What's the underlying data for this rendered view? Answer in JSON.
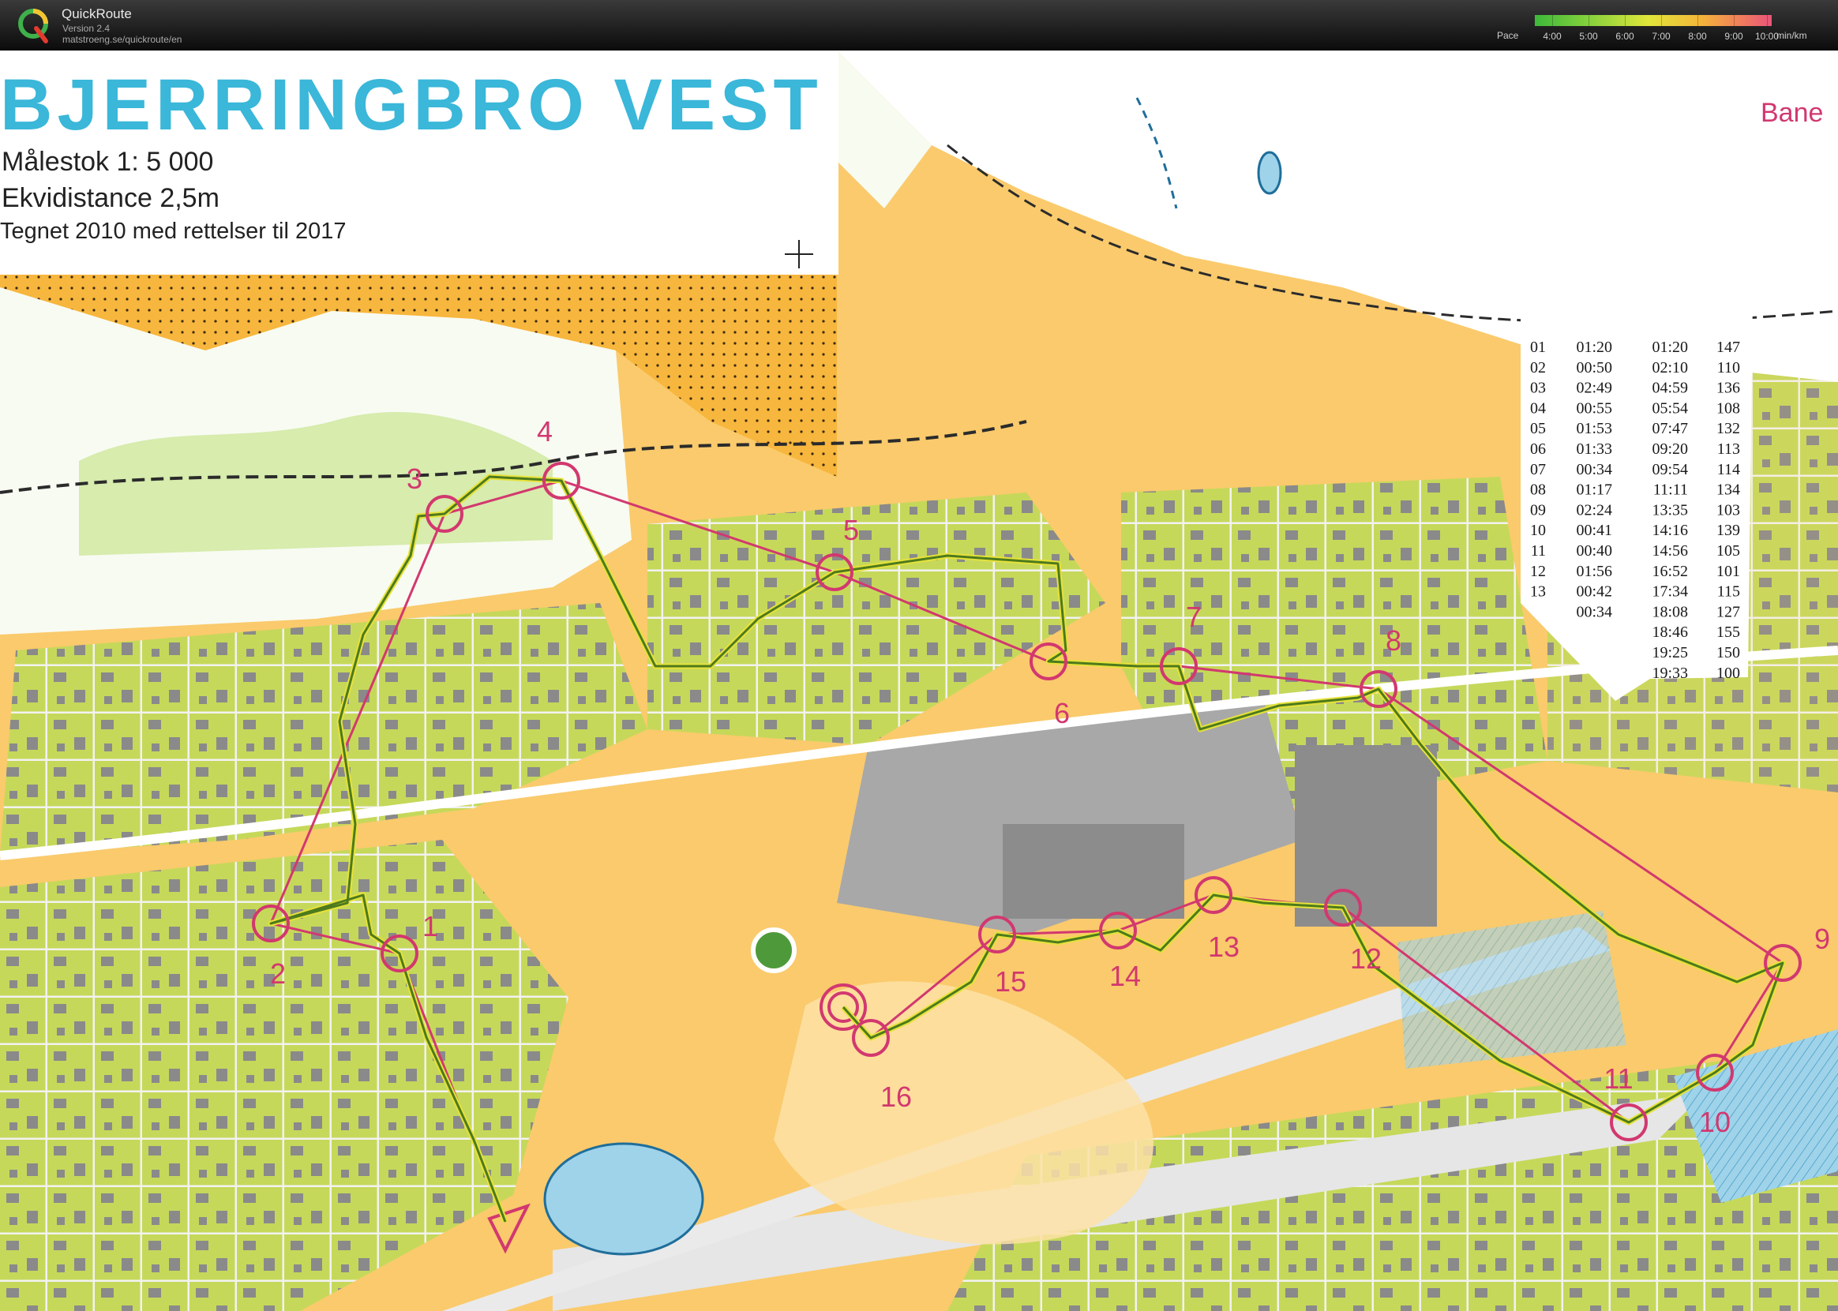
{
  "app": {
    "name": "QuickRoute",
    "version": "Version 2.4",
    "url": "matstroeng.se/quickroute/en"
  },
  "pace_scale": {
    "label": "Pace",
    "ticks": [
      "4:00",
      "5:00",
      "6:00",
      "7:00",
      "8:00",
      "9:00",
      "10:00"
    ],
    "unit": "min/km",
    "colors": [
      "#3db93a",
      "#8dd33d",
      "#e0e63a",
      "#f4b43a",
      "#ef7a5e",
      "#e9547b"
    ]
  },
  "map": {
    "title": "BJERRINGBRO  VEST",
    "scale": "Målestok 1: 5 000",
    "contour": "Ekvidistance 2,5m",
    "drawn": "Tegnet 2010 med rettelser til 2017",
    "course_label": "Bane",
    "colors": {
      "open": "#f7b63d",
      "rough_open": "#fde2a6",
      "forest": "#ffffff",
      "green": "#c9e590",
      "residential": "#c6d85a",
      "water": "#9fd3ea",
      "building": "#8c8c8c",
      "overprint": "#d2386f",
      "route": "#4d7a1d"
    },
    "controls": [
      {
        "label": "1"
      },
      {
        "label": "2"
      },
      {
        "label": "3"
      },
      {
        "label": "4"
      },
      {
        "label": "5"
      },
      {
        "label": "6"
      },
      {
        "label": "7"
      },
      {
        "label": "8"
      },
      {
        "label": "9"
      },
      {
        "label": "10"
      },
      {
        "label": "11"
      },
      {
        "label": "12"
      },
      {
        "label": "13"
      },
      {
        "label": "14"
      },
      {
        "label": "15"
      },
      {
        "label": "16"
      }
    ]
  },
  "splits": [
    {
      "num": "01",
      "leg": "01:20",
      "total": "01:20",
      "hr": "147"
    },
    {
      "num": "02",
      "leg": "00:50",
      "total": "02:10",
      "hr": "110"
    },
    {
      "num": "03",
      "leg": "02:49",
      "total": "04:59",
      "hr": "136"
    },
    {
      "num": "04",
      "leg": "00:55",
      "total": "05:54",
      "hr": "108"
    },
    {
      "num": "05",
      "leg": "01:53",
      "total": "07:47",
      "hr": "132"
    },
    {
      "num": "06",
      "leg": "01:33",
      "total": "09:20",
      "hr": "113"
    },
    {
      "num": "07",
      "leg": "00:34",
      "total": "09:54",
      "hr": "114"
    },
    {
      "num": "08",
      "leg": "01:17",
      "total": "11:11",
      "hr": "134"
    },
    {
      "num": "09",
      "leg": "02:24",
      "total": "13:35",
      "hr": "103"
    },
    {
      "num": "10",
      "leg": "00:41",
      "total": "14:16",
      "hr": "139"
    },
    {
      "num": "11",
      "leg": "00:40",
      "total": "14:56",
      "hr": "105"
    },
    {
      "num": "12",
      "leg": "01:56",
      "total": "16:52",
      "hr": "101"
    },
    {
      "num": "13",
      "leg": "00:42",
      "total": "17:34",
      "hr": "115"
    },
    {
      "num": "",
      "leg": "00:34",
      "total": "18:08",
      "hr": "127"
    },
    {
      "num": "",
      "leg": "",
      "total": "18:46",
      "hr": "155"
    },
    {
      "num": "",
      "leg": "",
      "total": "19:25",
      "hr": "150"
    },
    {
      "num": "",
      "leg": "",
      "total": "19:33",
      "hr": "100"
    }
  ]
}
